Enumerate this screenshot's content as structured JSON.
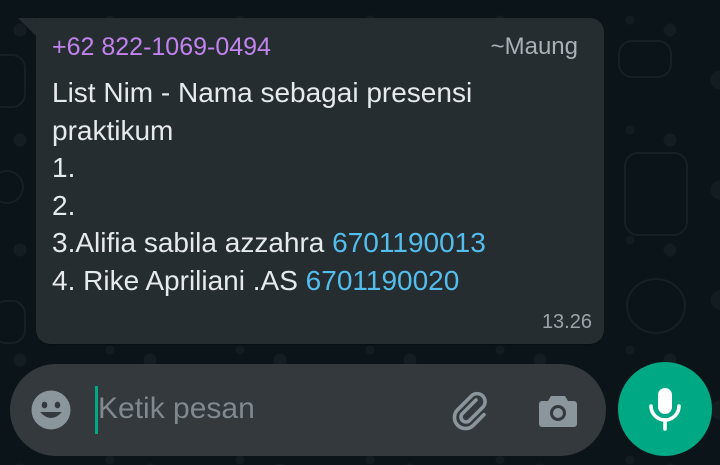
{
  "message": {
    "sender_number": "+62 822-1069-0494",
    "sender_name": "~Maung",
    "lines": [
      "List Nim - Nama sebagai presensi praktikum",
      "1.",
      "2."
    ],
    "entry3_text": "3.Alifia sabila azzahra ",
    "entry3_number": "6701190013",
    "entry4_text": "4. Rike Apriliani .AS ",
    "entry4_number": "6701190020",
    "time": "13.26"
  },
  "composer": {
    "placeholder": "Ketik pesan",
    "emoji_icon": "emoji-icon",
    "attach_icon": "paperclip-icon",
    "camera_icon": "camera-icon",
    "mic_icon": "microphone-icon"
  },
  "colors": {
    "bubble": "#262d31",
    "sender_number": "#c183ed",
    "link": "#53bdeb",
    "accent": "#00a884"
  }
}
